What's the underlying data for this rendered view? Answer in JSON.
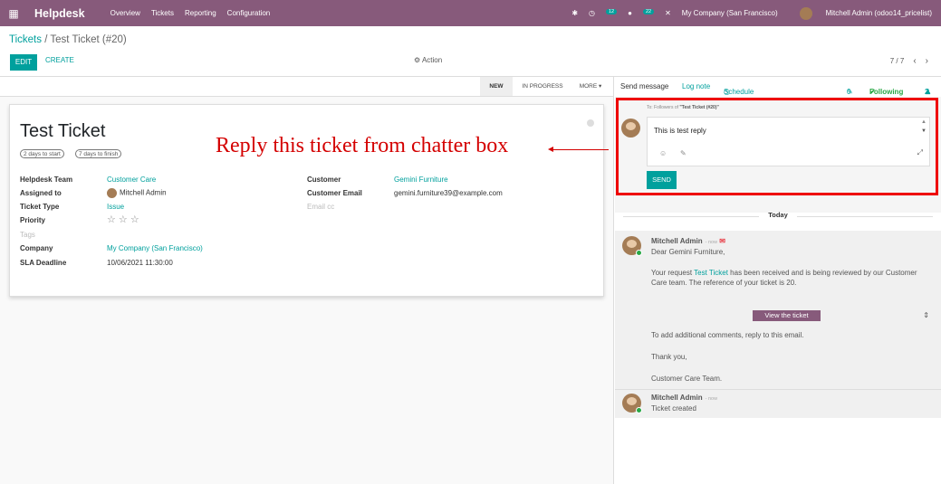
{
  "navbar": {
    "app_name": "Helpdesk",
    "menu": [
      "Overview",
      "Tickets",
      "Reporting",
      "Configuration"
    ],
    "activity_count": "12",
    "message_count": "22",
    "company": "My Company (San Francisco)",
    "user": "Mitchell Admin (odoo14_pricelist)"
  },
  "control_panel": {
    "breadcrumb_parent": "Tickets",
    "breadcrumb_sep": " / ",
    "breadcrumb_current": "Test Ticket (#20)",
    "edit_label": "EDIT",
    "create_label": "CREATE",
    "action_label": "Action",
    "pager": "7 / 7"
  },
  "stages": {
    "new": "NEW",
    "in_progress": "IN PROGRESS",
    "more": "MORE"
  },
  "ticket": {
    "title": "Test Ticket",
    "pill1": "2 days to start",
    "pill2": "7 days to finish",
    "team_label": "Helpdesk Team",
    "team_value": "Customer Care",
    "assigned_label": "Assigned to",
    "assigned_value": "Mitchell Admin",
    "type_label": "Ticket Type",
    "type_value": "Issue",
    "priority_label": "Priority",
    "priority_value": "☆ ☆ ☆",
    "tags_label": "Tags",
    "company_label": "Company",
    "company_value": "My Company (San Francisco)",
    "sla_label": "SLA Deadline",
    "sla_value": "10/06/2021 11:30:00",
    "customer_label": "Customer",
    "customer_value": "Gemini Furniture",
    "email_label": "Customer Email",
    "email_value": "gemini.furniture39@example.com",
    "emailcc_label": "Email cc"
  },
  "annotation": "Reply this ticket from chatter box",
  "chatter": {
    "send_message": "Send message",
    "log_note": "Log note",
    "schedule": "Schedule activity",
    "attachments": "0",
    "following": "Following",
    "followers": "2",
    "to_prefix": "To: Followers of ",
    "to_name": "\"Test Ticket (#20)\"",
    "composer_text": "This is test reply",
    "send_label": "SEND",
    "today": "Today",
    "msg1_author": "Mitchell Admin",
    "msg1_time": "- now",
    "msg1_greeting": "Dear Gemini Furniture,",
    "msg1_p1a": "Your request ",
    "msg1_link": "Test Ticket",
    "msg1_p1b": " has been received and is being reviewed by our Customer Care team. The reference of your ticket is 20.",
    "msg1_view": "View the ticket",
    "msg1_p2": "To add additional comments, reply to this email.",
    "msg1_p3": "Thank you,",
    "msg1_p4": "Customer Care Team.",
    "msg2_author": "Mitchell Admin",
    "msg2_time": "- now",
    "msg2_body": "Ticket created"
  }
}
